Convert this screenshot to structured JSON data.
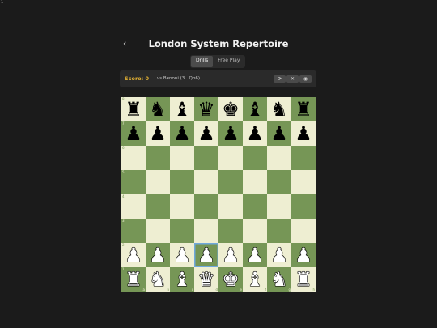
{
  "corner_mark": "1",
  "header": {
    "back_icon": "chevron-left-icon",
    "back_glyph": "‹",
    "title": "London System Repertoire"
  },
  "tabs": [
    {
      "label": "Drills",
      "active": true
    },
    {
      "label": "Free Play",
      "active": false
    }
  ],
  "toolbar": {
    "score_label": "Score: 0",
    "opening": "vs Benoni (3...Qb6)",
    "buttons": [
      {
        "name": "flip-board-button",
        "icon": "rotate-icon",
        "glyph": "⟳"
      },
      {
        "name": "close-button",
        "icon": "close-icon",
        "glyph": "✕"
      },
      {
        "name": "view-button",
        "icon": "eye-icon",
        "glyph": "◉"
      }
    ]
  },
  "board": {
    "files": [
      "a",
      "b",
      "c",
      "d",
      "e",
      "f",
      "g",
      "h"
    ],
    "ranks": [
      "8",
      "7",
      "6",
      "5",
      "4",
      "3",
      "2",
      "1"
    ],
    "position": [
      [
        "r",
        "n",
        "b",
        "q",
        "k",
        "b",
        "n",
        "r"
      ],
      [
        "p",
        "p",
        "p",
        "p",
        "p",
        "p",
        "p",
        "p"
      ],
      [
        "",
        "",
        "",
        "",
        "",
        "",
        "",
        ""
      ],
      [
        "",
        "",
        "",
        "",
        "",
        "",
        "",
        ""
      ],
      [
        "",
        "",
        "",
        "",
        "",
        "",
        "",
        ""
      ],
      [
        "",
        "",
        "",
        "",
        "",
        "",
        "",
        ""
      ],
      [
        "P",
        "P",
        "P",
        "P",
        "P",
        "P",
        "P",
        "P"
      ],
      [
        "R",
        "N",
        "B",
        "Q",
        "K",
        "B",
        "N",
        "R"
      ]
    ],
    "highlighted_square": "d2",
    "colors": {
      "light": "#eeeed2",
      "dark": "#769656",
      "highlight": "#6fa8dc"
    }
  }
}
